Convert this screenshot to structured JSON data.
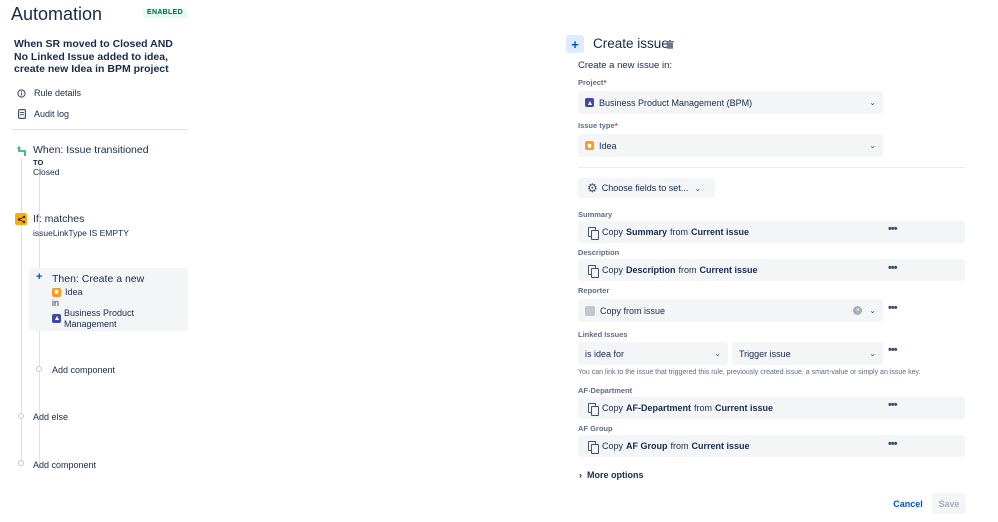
{
  "header": {
    "title": "Automation",
    "status_badge": "ENABLED"
  },
  "rule": {
    "name": "When SR moved to Closed AND No Linked Issue added to idea, create new Idea in BPM project"
  },
  "nav": [
    {
      "label": "Rule details",
      "icon": "info-icon"
    },
    {
      "label": "Audit log",
      "icon": "document-icon"
    }
  ],
  "steps": {
    "trigger": {
      "title": "When: Issue transitioned",
      "to_label": "TO",
      "to_value": "Closed"
    },
    "condition": {
      "title": "If: matches",
      "detail": "issueLinkType IS EMPTY"
    },
    "action": {
      "title": "Then: Create a new",
      "issue_type": "Idea",
      "in_label": "in",
      "project": "Business Product Management"
    },
    "add_component_inner": "Add component",
    "add_else": "Add else",
    "add_component_outer": "Add component"
  },
  "panel": {
    "title": "Create issue",
    "subtitle": "Create a new issue in:",
    "project_label": "Project",
    "required_mark": "*",
    "project_value": "Business Product Management (BPM)",
    "issue_type_label": "Issue type",
    "issue_type_value": "Idea",
    "choose_fields": "Choose fields to set...",
    "fields": {
      "summary": {
        "label": "Summary",
        "copy": "Copy",
        "field": "Summary",
        "from": "from",
        "source": "Current issue"
      },
      "description": {
        "label": "Description",
        "copy": "Copy",
        "field": "Description",
        "from": "from",
        "source": "Current issue"
      },
      "reporter": {
        "label": "Reporter",
        "value": "Copy from issue"
      },
      "linked_issues": {
        "label": "Linked Issues",
        "link_type": "is idea for",
        "target": "Trigger issue",
        "help": "You can link to the issue that triggered this rule, previously created issue, a smart-value or simply an issue key."
      },
      "af_department": {
        "label": "AF-Department",
        "copy": "Copy",
        "field": "AF-Department",
        "from": "from",
        "source": "Current issue"
      },
      "af_group": {
        "label": "AF Group",
        "copy": "Copy",
        "field": "AF Group",
        "from": "from",
        "source": "Current issue"
      }
    },
    "more_options": "More options",
    "cancel": "Cancel",
    "save": "Save"
  },
  "colors": {
    "accent": "#0052cc",
    "idea": "#ff991f",
    "project": "#3d4aa6",
    "trigger": "#36b37e",
    "condition": "#ffab00",
    "badge_bg": "#e3fcef",
    "badge_text": "#006644"
  }
}
